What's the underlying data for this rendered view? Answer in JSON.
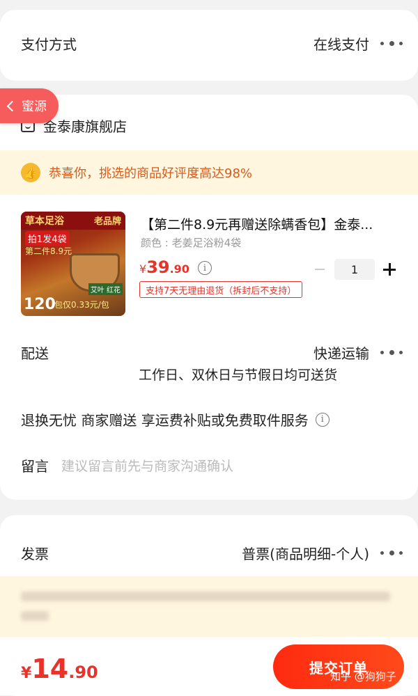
{
  "payment": {
    "label": "支付方式",
    "value": "在线支付"
  },
  "source_tag": {
    "label": "蜜源"
  },
  "shop": {
    "name": "金泰康旗舰店"
  },
  "praise": {
    "text": "恭喜你，挑选的商品好评度高达98%"
  },
  "product": {
    "title": "【第二件8.9元再赠送除螨香包】金泰...",
    "spec": "颜色 : 老姜足浴粉4袋",
    "price_symbol": "¥",
    "price_int": "39",
    "price_dec": ".90",
    "return_tag": "支持7天无理由退货（拆封后不支持）",
    "quantity": "1",
    "image_text": {
      "line1": "草本足浴",
      "line2": "老品牌",
      "line3": "拍1发4袋",
      "line4": "第二件8.9元",
      "count": "120",
      "price_note": "包仅0.33元/包",
      "herbs": "艾叶 红花"
    }
  },
  "delivery": {
    "label": "配送",
    "method": "快递运输",
    "note": "工作日、双休日与节假日均可送货"
  },
  "service": {
    "text": "退换无忧 商家赠送 享运费补贴或免费取件服务"
  },
  "message": {
    "label": "留言",
    "placeholder": "建议留言前先与商家沟通确认"
  },
  "invoice": {
    "label": "发票",
    "value": "普票(商品明细-个人)"
  },
  "footer": {
    "price_symbol": "¥",
    "price_int": "14",
    "price_dec": ".90",
    "submit_label": "提交订单",
    "watermark": "知乎 @狗狗子"
  },
  "colors": {
    "accent": "#e8322a",
    "submit": "#ff2a10",
    "praise_bg": "#fff6e0",
    "praise_text": "#d95a1a",
    "source_tag": "#f65c5c"
  },
  "icons": [
    "more-dots-icon",
    "chevron-left-icon",
    "shop-icon",
    "thumbs-up-icon",
    "info-icon",
    "minus-icon",
    "plus-icon"
  ]
}
